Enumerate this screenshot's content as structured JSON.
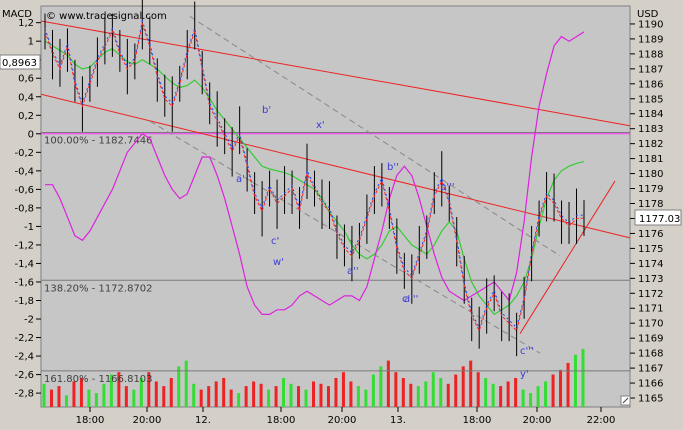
{
  "chart_data": {
    "type": "line",
    "left_axis_title": "MACD",
    "right_axis_title": "USD",
    "copyright": "© www.tradesignal.com",
    "left_ticks": [
      "1,2",
      "1",
      "0,8",
      "0,6",
      "0,4",
      "0,2",
      "0",
      "-0,2",
      "-0,4",
      "-0,6",
      "-0,8",
      "-1",
      "-1,2",
      "-1,4",
      "-1,6",
      "-1,8",
      "-2",
      "-2,2",
      "-2,4",
      "-2,6",
      "-2,8"
    ],
    "left_ylim": [
      -2.95,
      1.38
    ],
    "right_ticks": [
      "1190",
      "1189",
      "1188",
      "1187",
      "1186",
      "1185",
      "1184",
      "1183",
      "1182",
      "1181",
      "1180",
      "1179",
      "1178",
      "1177",
      "1176",
      "1175",
      "1174",
      "1173",
      "1172",
      "1171",
      "1170",
      "1169",
      "1168",
      "1167",
      "1166",
      "1165"
    ],
    "right_ylim": [
      1164.4,
      1191.2
    ],
    "x_ticks": [
      "18:00",
      "20:00",
      "12.",
      "18:00",
      "20:00",
      "13.",
      "18:00",
      "20:00",
      "22:00"
    ],
    "macd_value_marker": "0,8963",
    "macd_value": 0.8963,
    "price_value_marker": "1177.03",
    "price_value": 1177.03,
    "fib_levels": [
      {
        "label": "100.00% - 1182.7446",
        "price": 1182.7446
      },
      {
        "label": "138.20% - 1172.8702",
        "price": 1172.8702
      },
      {
        "label": "161.80% - 1166.8103",
        "price": 1166.8103
      }
    ],
    "wave_labels": [
      "b'",
      "a'",
      "c'",
      "w'",
      "x'",
      "b''",
      "a''",
      "c''",
      "b'''",
      "a'''",
      "c'''",
      "y'"
    ],
    "price_series": [
      1189.5,
      1188.0,
      1187.0,
      1188.5,
      1186.0,
      1184.5,
      1186.0,
      1187.5,
      1188.5,
      1189.5,
      1188.0,
      1187.0,
      1187.5,
      1190.0,
      1188.5,
      1186.5,
      1185.0,
      1184.5,
      1186.0,
      1188.0,
      1189.5,
      1187.0,
      1184.5,
      1183.5,
      1182.5,
      1181.5,
      1182.5,
      1180.5,
      1178.5,
      1177.5,
      1179.0,
      1178.0,
      1178.5,
      1179.0,
      1177.5,
      1180.0,
      1179.0,
      1178.0,
      1177.5,
      1176.0,
      1175.0,
      1174.5,
      1175.5,
      1177.0,
      1178.5,
      1179.5,
      1177.5,
      1175.0,
      1173.5,
      1173.0,
      1174.5,
      1176.0,
      1178.5,
      1179.5,
      1178.0,
      1175.5,
      1172.5,
      1170.5,
      1169.5,
      1171.0,
      1172.0,
      1170.5,
      1170.0,
      1169.5,
      1171.5,
      1174.5,
      1177.0,
      1178.5,
      1178.0,
      1177.0,
      1176.5,
      1177.0,
      1177.03
    ],
    "macd_series": [
      1.0,
      0.95,
      0.9,
      0.85,
      0.75,
      0.7,
      0.72,
      0.8,
      0.88,
      0.92,
      0.85,
      0.78,
      0.75,
      0.8,
      0.75,
      0.7,
      0.62,
      0.55,
      0.5,
      0.52,
      0.58,
      0.5,
      0.38,
      0.25,
      0.15,
      0.05,
      -0.05,
      -0.15,
      -0.25,
      -0.35,
      -0.38,
      -0.4,
      -0.42,
      -0.45,
      -0.5,
      -0.55,
      -0.6,
      -0.7,
      -0.85,
      -0.95,
      -1.05,
      -1.2,
      -1.3,
      -1.35,
      -1.3,
      -1.2,
      -1.05,
      -1.0,
      -1.1,
      -1.2,
      -1.25,
      -1.3,
      -1.2,
      -1.05,
      -0.95,
      -1.05,
      -1.35,
      -1.6,
      -1.75,
      -1.85,
      -1.95,
      -1.9,
      -1.85,
      -1.75,
      -1.6,
      -1.35,
      -1.0,
      -0.7,
      -0.5,
      -0.4,
      -0.35,
      -0.32,
      -0.3
    ],
    "signal_series": [
      -0.55,
      -0.55,
      -0.7,
      -0.9,
      -1.1,
      -1.15,
      -1.05,
      -0.9,
      -0.75,
      -0.6,
      -0.4,
      -0.2,
      -0.1,
      0.0,
      -0.05,
      -0.25,
      -0.45,
      -0.6,
      -0.7,
      -0.65,
      -0.45,
      -0.25,
      -0.25,
      -0.45,
      -0.7,
      -1.0,
      -1.3,
      -1.65,
      -1.85,
      -1.95,
      -1.95,
      -1.9,
      -1.9,
      -1.85,
      -1.75,
      -1.7,
      -1.75,
      -1.8,
      -1.85,
      -1.8,
      -1.75,
      -1.75,
      -1.8,
      -1.65,
      -1.35,
      -1.05,
      -0.7,
      -0.45,
      -0.35,
      -0.45,
      -0.7,
      -1.0,
      -1.3,
      -1.55,
      -1.7,
      -1.75,
      -1.8,
      -1.75,
      -1.7,
      -1.65,
      -1.6,
      -1.7,
      -1.8,
      -1.5,
      -0.95,
      -0.25,
      0.3,
      0.65,
      0.95,
      1.05,
      1.0,
      1.05,
      1.1
    ],
    "volume_series": [
      20,
      15,
      18,
      10,
      22,
      25,
      15,
      12,
      20,
      28,
      30,
      18,
      15,
      25,
      30,
      22,
      18,
      25,
      35,
      40,
      20,
      15,
      18,
      22,
      25,
      15,
      12,
      18,
      22,
      20,
      15,
      18,
      25,
      20,
      18,
      15,
      22,
      20,
      18,
      25,
      30,
      22,
      18,
      15,
      28,
      35,
      40,
      30,
      25,
      20,
      18,
      22,
      30,
      25,
      20,
      28,
      35,
      40,
      30,
      25,
      20,
      18,
      22,
      25,
      15,
      12,
      18,
      22,
      28,
      32,
      38,
      45,
      50
    ]
  }
}
